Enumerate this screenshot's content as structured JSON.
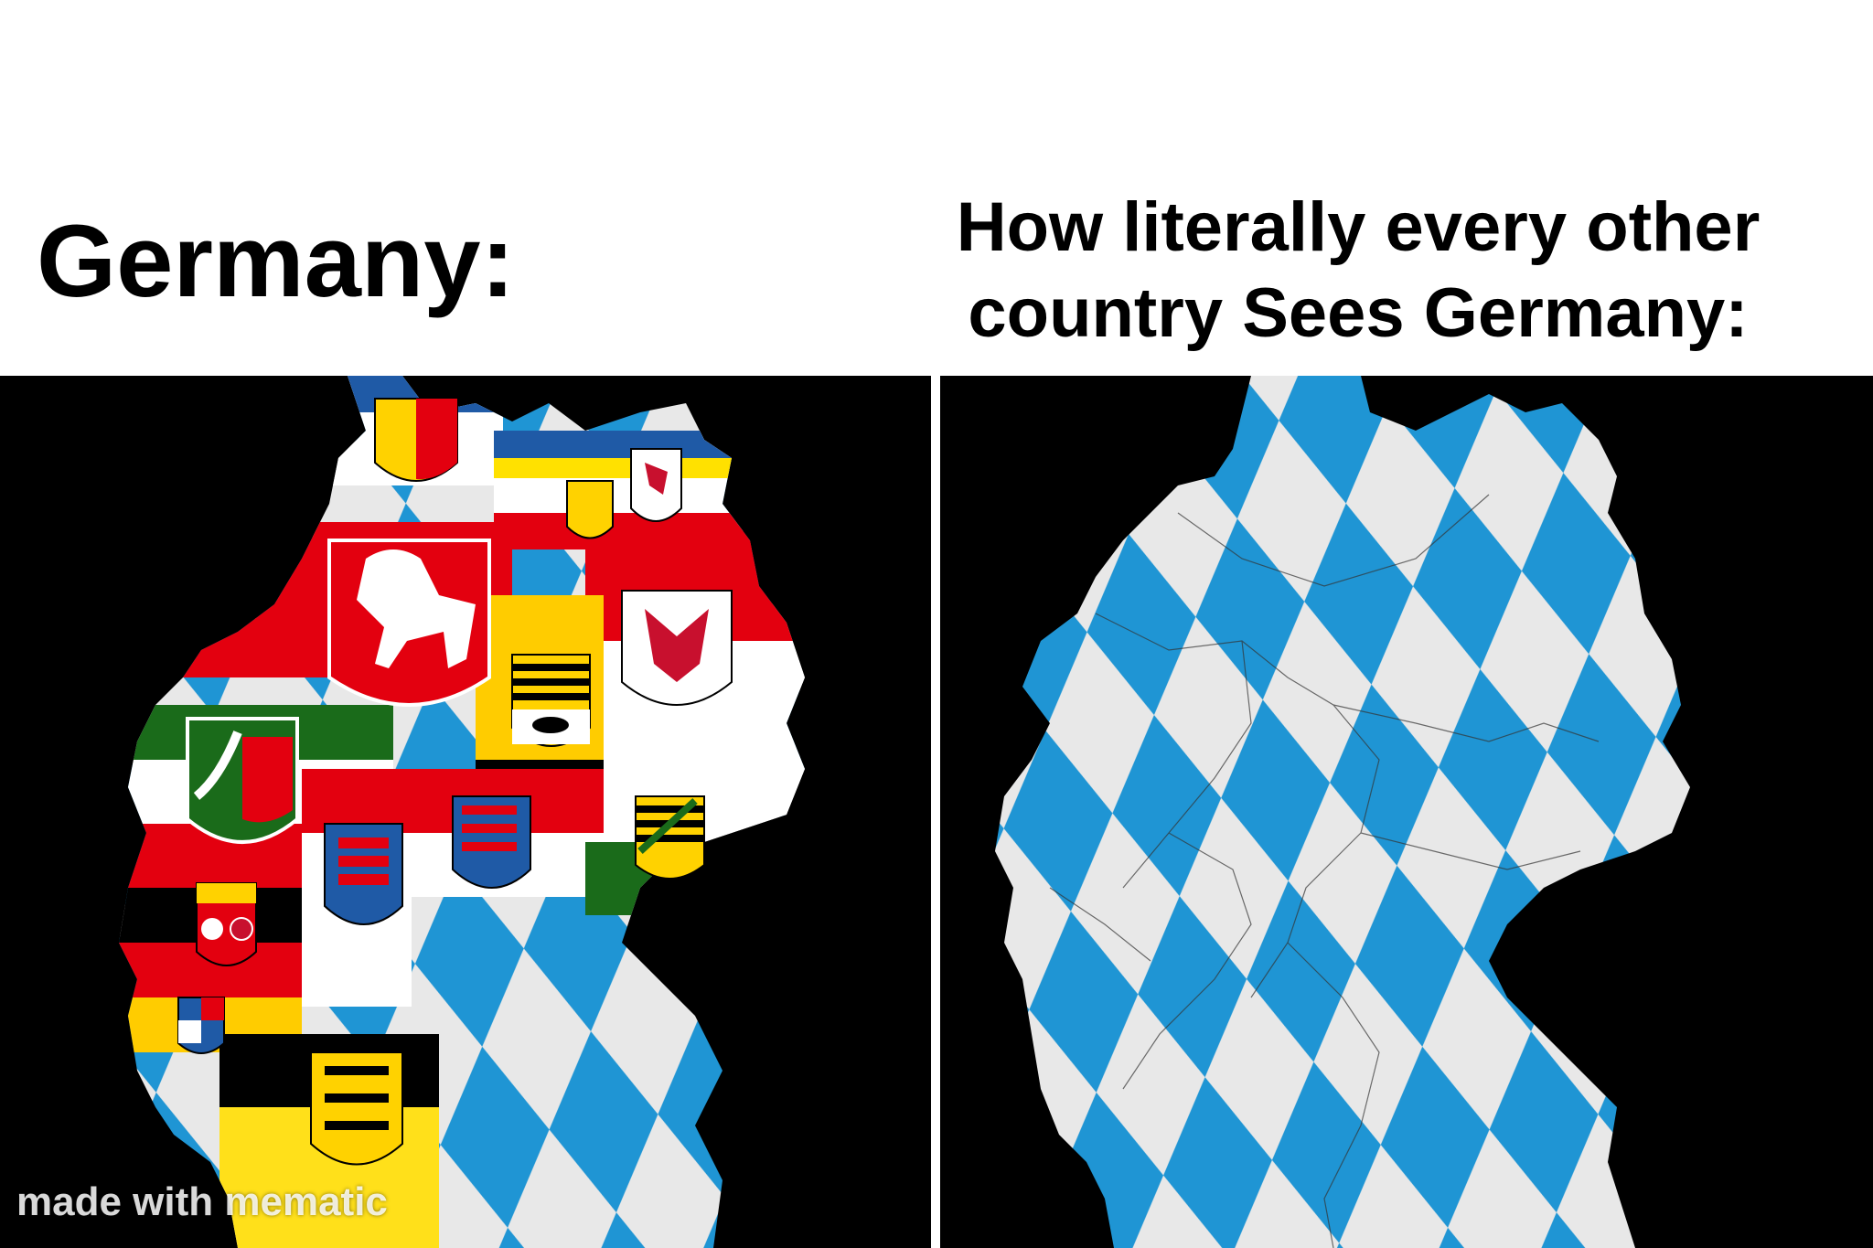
{
  "captions": {
    "left": "Germany:",
    "right_line1": "How literally every other",
    "right_line2": "country Sees Germany:"
  },
  "watermark": "made with mematic",
  "colors": {
    "bavaria_blue": "#1f95d4",
    "bavaria_white": "#e8e8e8",
    "red": "#e3000f",
    "yellow": "#ffcc00",
    "green": "#1a6b1a",
    "black": "#000000"
  }
}
